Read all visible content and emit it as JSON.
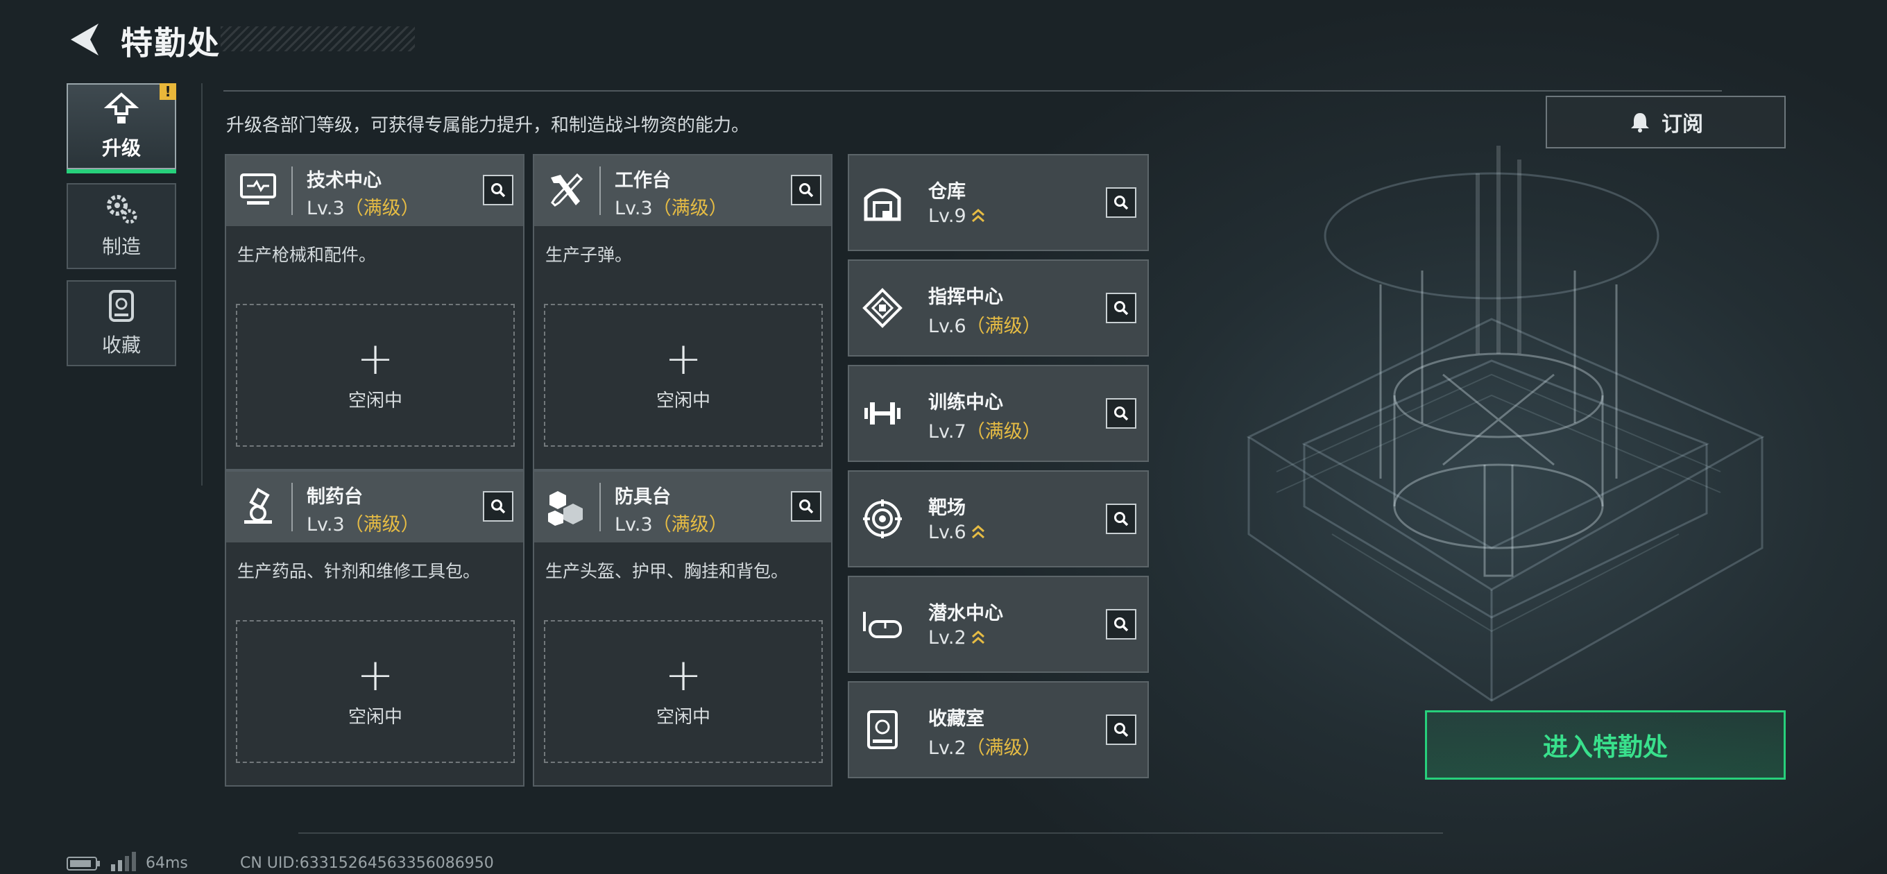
{
  "header": {
    "title": "特勤处"
  },
  "nav": {
    "tabs": [
      {
        "label": "升级",
        "active": true,
        "icon": "upgrade-icon",
        "alert": "!"
      },
      {
        "label": "制造",
        "active": false,
        "icon": "gears-icon"
      },
      {
        "label": "收藏",
        "active": false,
        "icon": "collection-icon"
      }
    ]
  },
  "description": "升级各部门等级，可获得专属能力提升，和制造战斗物资的能力。",
  "subscribe": {
    "label": "订阅",
    "icon": "bell-icon"
  },
  "workshops": [
    {
      "name": "技术中心",
      "level": "Lv.3",
      "status": "（满级）",
      "desc": "生产枪械和配件。",
      "slot_plus": "+",
      "slot_label": "空闲中",
      "icon": "tech-center-icon"
    },
    {
      "name": "工作台",
      "level": "Lv.3",
      "status": "（满级）",
      "desc": "生产子弹。",
      "slot_plus": "+",
      "slot_label": "空闲中",
      "icon": "workbench-icon"
    },
    {
      "name": "制药台",
      "level": "Lv.3",
      "status": "（满级）",
      "desc": "生产药品、针剂和维修工具包。",
      "slot_plus": "+",
      "slot_label": "空闲中",
      "icon": "pharmacy-icon"
    },
    {
      "name": "防具台",
      "level": "Lv.3",
      "status": "（满级）",
      "desc": "生产头盔、护甲、胸挂和背包。",
      "slot_plus": "+",
      "slot_label": "空闲中",
      "icon": "armor-bench-icon"
    }
  ],
  "departments": [
    {
      "name": "仓库",
      "level": "Lv.9",
      "status": "",
      "upgradable": true,
      "icon": "warehouse-icon"
    },
    {
      "name": "指挥中心",
      "level": "Lv.6",
      "status": "（满级）",
      "upgradable": false,
      "icon": "command-center-icon"
    },
    {
      "name": "训练中心",
      "level": "Lv.7",
      "status": "（满级）",
      "upgradable": false,
      "icon": "dumbbell-icon"
    },
    {
      "name": "靶场",
      "level": "Lv.6",
      "status": "",
      "upgradable": true,
      "icon": "target-icon"
    },
    {
      "name": "潜水中心",
      "level": "Lv.2",
      "status": "",
      "upgradable": true,
      "icon": "diving-mask-icon"
    },
    {
      "name": "收藏室",
      "level": "Lv.2",
      "status": "（满级）",
      "upgradable": false,
      "icon": "collection-room-icon"
    }
  ],
  "enter_button": {
    "label": "进入特勤处"
  },
  "status_bar": {
    "ping": "64ms",
    "uid": "CN UID:63315264563356086950"
  },
  "colors": {
    "accent_green": "#27d07b",
    "max_level_gold": "#e6bc44",
    "alert_yellow": "#e9b73a"
  }
}
